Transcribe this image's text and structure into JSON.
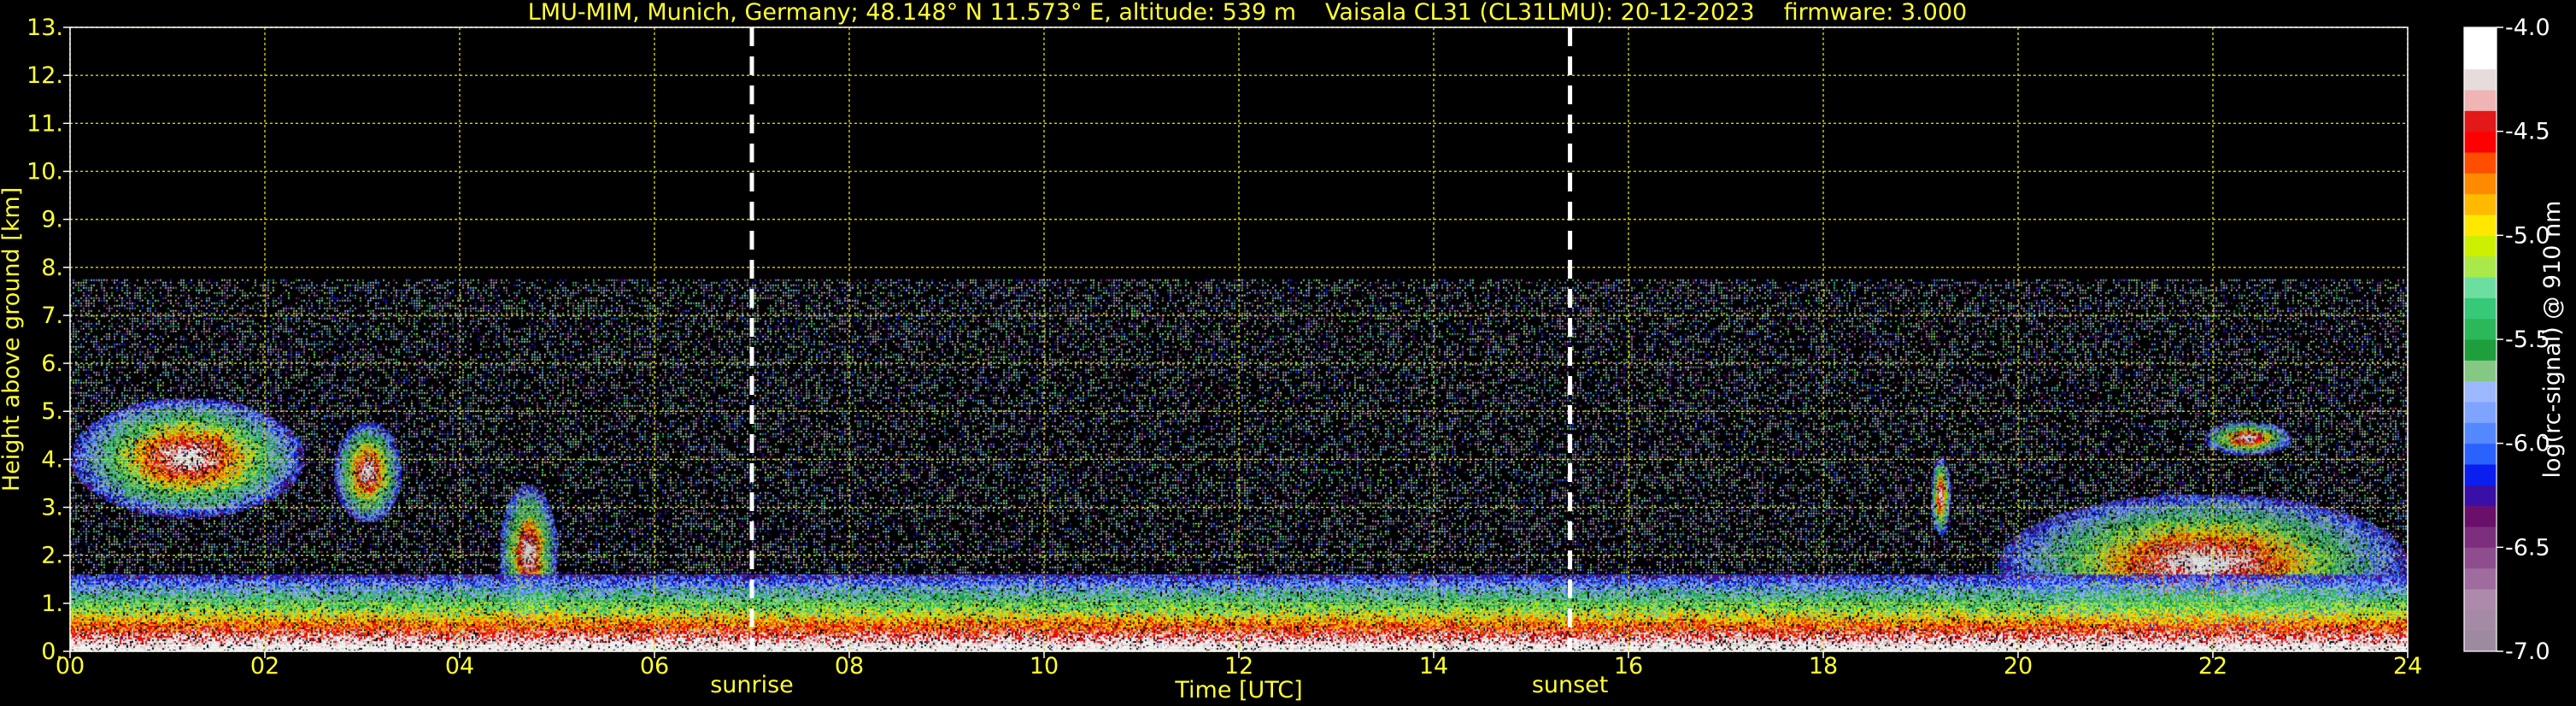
{
  "header": {
    "site": "LMU-MIM, Munich, Germany; 48.148° N 11.573° E, altitude: 539 m",
    "instrument": "Vaisala CL31 (CL31LMU): 20-12-2023",
    "firmware": "firmware: 3.000"
  },
  "colors": {
    "background": "#000000",
    "axis_text": "#ffff33",
    "grid": "#d4d400",
    "marker": "#ffffff",
    "colorbar_label": "#ffffff"
  },
  "chart_data": {
    "type": "heatmap",
    "xlabel": "Time [UTC]",
    "ylabel": "Height above ground [km]",
    "xlim": [
      0,
      24
    ],
    "ylim": [
      0,
      13
    ],
    "x_ticks": [
      "00",
      "02",
      "04",
      "06",
      "08",
      "10",
      "12",
      "14",
      "16",
      "18",
      "20",
      "22",
      "24"
    ],
    "y_ticks": [
      "0.",
      "1.",
      "2.",
      "3.",
      "4.",
      "5.",
      "6.",
      "7.",
      "8.",
      "9.",
      "10.",
      "11.",
      "12.",
      "13."
    ],
    "grid": true,
    "signal_top_km": 7.75,
    "markers": [
      {
        "label": "sunrise",
        "x": 7.0
      },
      {
        "label": "sunset",
        "x": 15.4
      }
    ],
    "colorbar": {
      "label": "log(rc-signal) @ 910 nm",
      "min": -7.0,
      "max": -4.0,
      "ticks": [
        "-4.0",
        "-4.5",
        "-5.0",
        "-5.5",
        "-6.0",
        "-6.5",
        "-7.0"
      ],
      "colors": [
        "#9d8aa0",
        "#a58aa6",
        "#ad8aac",
        "#9e6c9e",
        "#8e4e8e",
        "#7c2f7c",
        "#6a106a",
        "#3a0fa8",
        "#0a1ef0",
        "#2a62ff",
        "#5488ff",
        "#7ea4ff",
        "#9cb8ff",
        "#84c884",
        "#1e9e3c",
        "#2ab85a",
        "#35c978",
        "#6cdfa0",
        "#a9e94a",
        "#ccf000",
        "#ffe800",
        "#ffba00",
        "#ff8a00",
        "#ff4e00",
        "#ff0000",
        "#e31818",
        "#f0b4b4",
        "#e7dcdc",
        "#ffffff",
        "#ffffff"
      ]
    },
    "features": [
      {
        "kind": "cloud",
        "x0": 0.0,
        "x1": 2.4,
        "y0": 2.8,
        "y1": 5.3
      },
      {
        "kind": "cloud",
        "x0": 2.7,
        "x1": 3.4,
        "y0": 2.7,
        "y1": 4.8
      },
      {
        "kind": "cloud",
        "x0": 4.4,
        "x1": 5.0,
        "y0": 0.6,
        "y1": 3.5
      },
      {
        "kind": "cloud",
        "x0": 19.1,
        "x1": 19.3,
        "y0": 2.4,
        "y1": 4.1
      },
      {
        "kind": "cloud",
        "x0": 21.9,
        "x1": 22.8,
        "y0": 4.1,
        "y1": 4.8
      },
      {
        "kind": "cloud",
        "x0": 19.8,
        "x1": 24.0,
        "y0": 0.4,
        "y1": 3.3
      },
      {
        "kind": "boundary_layer",
        "x0": 0.0,
        "x1": 24.0,
        "y0": 0.0,
        "y1": 1.6
      }
    ]
  }
}
